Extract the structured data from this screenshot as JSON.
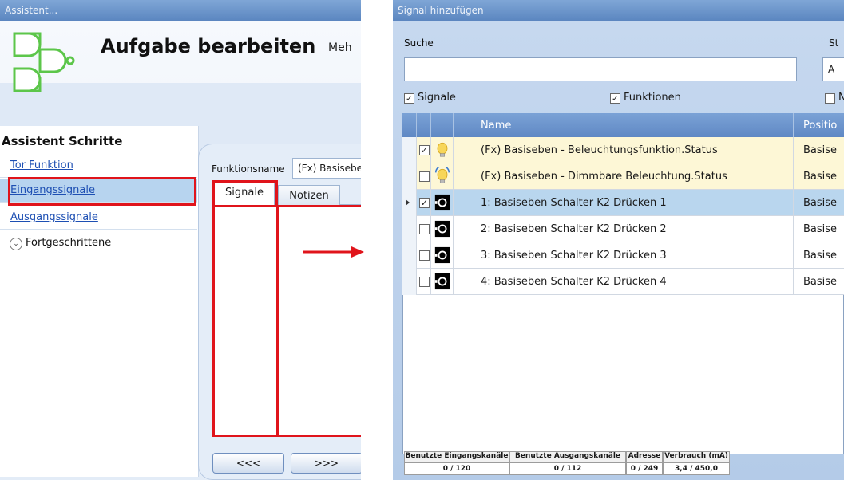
{
  "left_window": {
    "title": "Assistent...",
    "page_title": "Aufgabe bearbeiten",
    "page_more": "Meh",
    "steps_title": "Assistent Schritte",
    "steps": [
      "Tor Funktion",
      "Eingangssignale",
      "Ausgangssignale"
    ],
    "advanced_label": "Fortgeschrittene",
    "function_name_label": "Funktionsname",
    "function_name_value": "(Fx) Basiseben",
    "tabs": [
      "Signale",
      "Notizen"
    ],
    "nav_back": "<<<",
    "nav_next": ">>>"
  },
  "right_window": {
    "title": "Signal hinzufügen",
    "search_label": "Suche",
    "st_label": "St",
    "st_value": "A",
    "filters": [
      {
        "label": "Signale",
        "checked": true
      },
      {
        "label": "Funktionen",
        "checked": true
      },
      {
        "label": "N",
        "checked": false
      }
    ],
    "columns": [
      "Name",
      "Positio"
    ],
    "rows": [
      {
        "checked": true,
        "icon": "bulb-icon",
        "name": "(Fx) Basiseben - Beleuchtungsfunktion.Status",
        "position": "Basise",
        "style": "yellow"
      },
      {
        "checked": false,
        "icon": "dimmable-bulb-icon",
        "name": "(Fx) Basiseben - Dimmbare Beleuchtung.Status",
        "position": "Basise",
        "style": "yellow"
      },
      {
        "checked": true,
        "icon": "switch-icon",
        "name": "1: Basiseben Schalter K2 Drücken 1",
        "position": "Basise",
        "style": "selected"
      },
      {
        "checked": false,
        "icon": "switch-icon",
        "name": "2: Basiseben Schalter K2 Drücken 2",
        "position": "Basise",
        "style": "white"
      },
      {
        "checked": false,
        "icon": "switch-icon",
        "name": "3: Basiseben Schalter K2 Drücken 3",
        "position": "Basise",
        "style": "white"
      },
      {
        "checked": false,
        "icon": "switch-icon",
        "name": "4: Basiseben Schalter K2 Drücken 4",
        "position": "Basise",
        "style": "white"
      }
    ],
    "footer": [
      {
        "label": "Benutzte Eingangskanäle",
        "value": "0 / 120"
      },
      {
        "label": "Benutzte Ausgangskanäle",
        "value": "0 / 112"
      },
      {
        "label": "Adresse",
        "value": "0 / 249"
      },
      {
        "label": "Verbrauch (mA)",
        "value": "3,4 / 450,0"
      }
    ]
  },
  "colors": {
    "highlight_red": "#e0141b",
    "title_bar": "#6b93ca",
    "row_yellow": "#fdf7d6",
    "row_selected": "#b9d6ee",
    "link_blue": "#1d4fb3"
  }
}
